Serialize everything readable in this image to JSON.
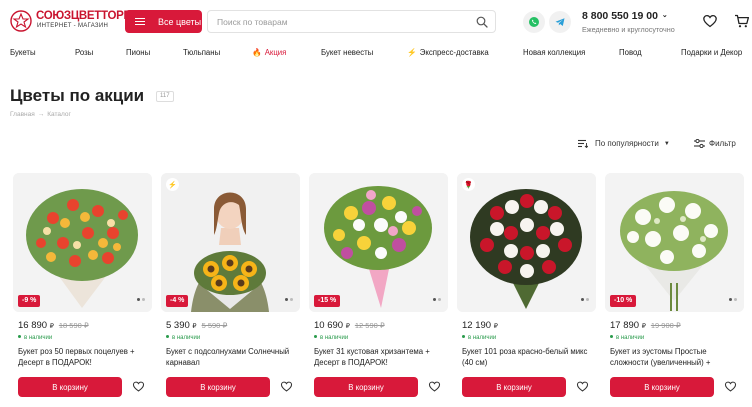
{
  "header": {
    "logo_name": "СОЮЗЦВЕТТОРГ",
    "logo_sub": "ИНТЕРНЕТ - МАГАЗИН",
    "all_flowers": "Все цветы",
    "search_placeholder": "Поиск по товарам",
    "phone": "8 800 550 19 00",
    "phone_sub": "Ежедневно и круглосуточно",
    "icons": [
      "whatsapp-icon",
      "telegram-icon",
      "heart-icon",
      "cart-icon"
    ]
  },
  "nav": [
    {
      "label": "Букеты",
      "icon": ""
    },
    {
      "label": "Розы",
      "icon": ""
    },
    {
      "label": "Пионы",
      "icon": ""
    },
    {
      "label": "Тюльпаны",
      "icon": ""
    },
    {
      "label": "Акция",
      "icon": "🔥"
    },
    {
      "label": "Букет невесты",
      "icon": ""
    },
    {
      "label": "Экспресс-доставка",
      "icon": "⚡"
    },
    {
      "label": "Новая коллекция",
      "icon": ""
    },
    {
      "label": "Повод",
      "icon": ""
    },
    {
      "label": "Подарки и Декор",
      "icon": ""
    }
  ],
  "page": {
    "title": "Цветы по акции",
    "count": "117",
    "breadcrumb": [
      "Главная",
      "Каталог"
    ],
    "breadcrumb_sep": "→"
  },
  "controls": {
    "sort_label": "По популярности",
    "filter_label": "Фильтр"
  },
  "colors": {
    "accent": "#d8193a",
    "in_stock": "#2a9b4c"
  },
  "products": [
    {
      "price": "16 890",
      "currency": "₽",
      "old_price": "18 590",
      "old_currency": "₽",
      "discount": "-9 %",
      "badge": "",
      "stock": "в наличии",
      "name": "Букет роз 50 первых поцелуев + Десерт в ПОДАРОК!",
      "cart": "В корзину"
    },
    {
      "price": "5 390",
      "currency": "₽",
      "old_price": "5 590",
      "old_currency": "₽",
      "discount": "-4 %",
      "badge": "⚡",
      "stock": "в наличии",
      "name": "Букет с подсолнухами Солнечный карнавал",
      "cart": "В корзину"
    },
    {
      "price": "10 690",
      "currency": "₽",
      "old_price": "12 590",
      "old_currency": "₽",
      "discount": "-15 %",
      "badge": "",
      "stock": "в наличии",
      "name": "Букет 31 кустовая хризантема + Десерт в ПОДАРОК!",
      "cart": "В корзину"
    },
    {
      "price": "12 190",
      "currency": "₽",
      "old_price": "",
      "old_currency": "",
      "discount": "",
      "badge": "🌹",
      "stock": "в наличии",
      "name": "Букет 101 роза красно-белый микс (40 см)",
      "cart": "В корзину"
    },
    {
      "price": "17 890",
      "currency": "₽",
      "old_price": "19 900",
      "old_currency": "₽",
      "discount": "-10 %",
      "badge": "",
      "stock": "в наличии",
      "name": "Букет из эустомы Простые сложности (увеличенный) +",
      "cart": "В корзину"
    }
  ]
}
